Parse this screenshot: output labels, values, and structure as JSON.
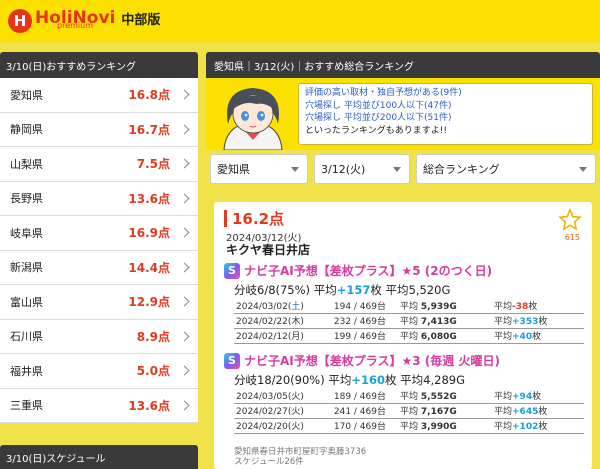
{
  "header": {
    "logo_mark": "H",
    "logo_name": "HoliNovi",
    "logo_sub": "premium",
    "region": "中部版"
  },
  "left_panel": {
    "title": "3/10(日)おすすめランキング",
    "items": [
      {
        "name": "愛知県",
        "score": "16.8点"
      },
      {
        "name": "静岡県",
        "score": "16.7点"
      },
      {
        "name": "山梨県",
        "score": "7.5点"
      },
      {
        "name": "長野県",
        "score": "13.6点"
      },
      {
        "name": "岐阜県",
        "score": "16.9点"
      },
      {
        "name": "新潟県",
        "score": "14.4点"
      },
      {
        "name": "富山県",
        "score": "12.9点"
      },
      {
        "name": "石川県",
        "score": "8.9点"
      },
      {
        "name": "福井県",
        "score": "5.0点"
      },
      {
        "name": "三重県",
        "score": "13.6点"
      }
    ],
    "schedule_title": "3/10(日)スケジュール"
  },
  "main": {
    "breadcrumb": "愛知県｜3/12(火)｜おすすめ総合ランキング",
    "intro": {
      "links": [
        "評価の高い取材・独自予想がある(9件)",
        "穴場探し 平均並び100人以下(47件)",
        "穴場探し 平均並び200人以下(51件)"
      ],
      "tail": "といったランキングもありますよ!!"
    },
    "filters": {
      "prefecture": "愛知県",
      "date": "3/12(火)",
      "ranking": "総合ランキング"
    },
    "card": {
      "score": "16.2点",
      "date": "2024/03/12(火)",
      "store": "キクヤ春日井店",
      "favorites": "615",
      "predictions": [
        {
          "title": "ナビ子AI予想【差枚プラス】★5 (2のつく日)",
          "summary_prefix": "分岐6/8(75%) 平均",
          "summary_diff": "+157",
          "summary_mid": "枚 平均",
          "summary_avg": "5,520G",
          "rows": [
            {
              "date_pre": "2024/03/02(",
              "dow": "土",
              "date_post": ")",
              "machines": "194 / 469台",
              "avg_games_label": "平均",
              "avg_games": "5,939G",
              "avg_diff_label": "平均",
              "avg_diff": "-38",
              "unit": "枚",
              "diff_sign": "neg"
            },
            {
              "date_pre": "2024/02/22(",
              "dow": "木",
              "date_post": ")",
              "machines": "232 / 469台",
              "avg_games_label": "平均",
              "avg_games": "7,413G",
              "avg_diff_label": "平均",
              "avg_diff": "+353",
              "unit": "枚",
              "diff_sign": "pos"
            },
            {
              "date_pre": "2024/02/12(",
              "dow": "月",
              "date_post": ")",
              "machines": "199 / 469台",
              "avg_games_label": "平均",
              "avg_games": "6,080G",
              "avg_diff_label": "平均",
              "avg_diff": "+40",
              "unit": "枚",
              "diff_sign": "pos"
            }
          ]
        },
        {
          "title": "ナビ子AI予想【差枚プラス】★3 (毎週 火曜日)",
          "summary_prefix": "分岐18/20(90%) 平均",
          "summary_diff": "+160",
          "summary_mid": "枚 平均",
          "summary_avg": "4,289G",
          "rows": [
            {
              "date_pre": "2024/03/05(",
              "dow": "火",
              "date_post": ")",
              "machines": "189 / 469台",
              "avg_games_label": "平均",
              "avg_games": "5,552G",
              "avg_diff_label": "平均",
              "avg_diff": "+94",
              "unit": "枚",
              "diff_sign": "pos"
            },
            {
              "date_pre": "2024/02/27(",
              "dow": "火",
              "date_post": ")",
              "machines": "241 / 469台",
              "avg_games_label": "平均",
              "avg_games": "7,167G",
              "avg_diff_label": "平均",
              "avg_diff": "+645",
              "unit": "枚",
              "diff_sign": "pos"
            },
            {
              "date_pre": "2024/02/20(",
              "dow": "火",
              "date_post": ")",
              "machines": "170 / 469台",
              "avg_games_label": "平均",
              "avg_games": "3,990G",
              "avg_diff_label": "平均",
              "avg_diff": "+102",
              "unit": "枚",
              "diff_sign": "pos"
            }
          ]
        }
      ],
      "address": "愛知県春日井市町屋町字奥藤3736",
      "schedule_count": "スケジュール26件"
    }
  },
  "colors": {
    "brand_yellow": "#fbe000",
    "accent_red": "#e03a1f",
    "positive_blue": "#1aa0d8",
    "prediction_pink": "#d83aa0"
  }
}
